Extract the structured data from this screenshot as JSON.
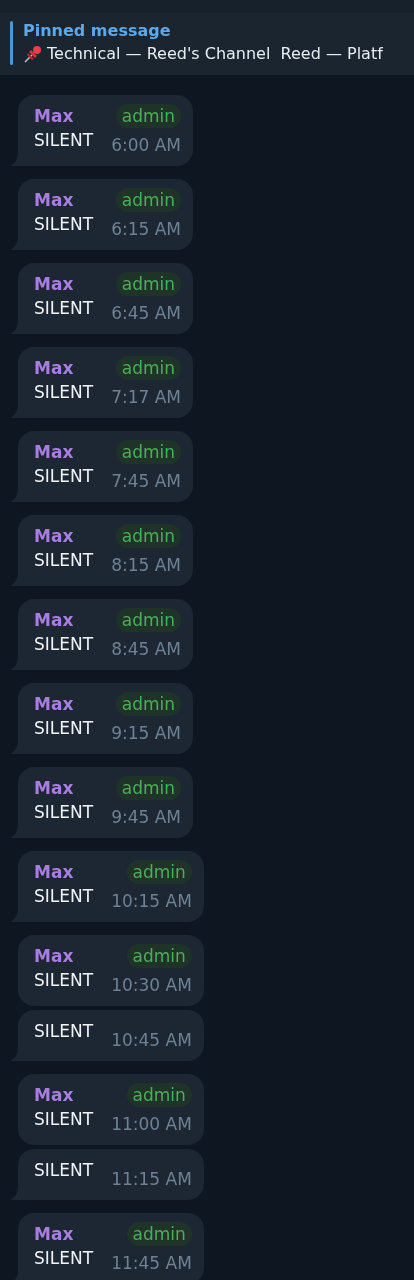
{
  "pinned": {
    "title": "Pinned message",
    "text": "Technical — Reed's Channel  Reed — Platf"
  },
  "messages": [
    {
      "sender": "Max",
      "badge": "admin",
      "text": "SILENT",
      "time": "6:00 AM"
    },
    {
      "sender": "Max",
      "badge": "admin",
      "text": "SILENT",
      "time": "6:15 AM"
    },
    {
      "sender": "Max",
      "badge": "admin",
      "text": "SILENT",
      "time": "6:45 AM"
    },
    {
      "sender": "Max",
      "badge": "admin",
      "text": "SILENT",
      "time": "7:17 AM"
    },
    {
      "sender": "Max",
      "badge": "admin",
      "text": "SILENT",
      "time": "7:45 AM"
    },
    {
      "sender": "Max",
      "badge": "admin",
      "text": "SILENT",
      "time": "8:15 AM"
    },
    {
      "sender": "Max",
      "badge": "admin",
      "text": "SILENT",
      "time": "8:45 AM"
    },
    {
      "sender": "Max",
      "badge": "admin",
      "text": "SILENT",
      "time": "9:15 AM"
    },
    {
      "sender": "Max",
      "badge": "admin",
      "text": "SILENT",
      "time": "9:45 AM"
    },
    {
      "sender": "Max",
      "badge": "admin",
      "text": "SILENT",
      "time": "10:15 AM"
    },
    {
      "sender": "Max",
      "badge": "admin",
      "text": "SILENT",
      "time": "10:30 AM"
    },
    {
      "text": "SILENT",
      "time": "10:45 AM"
    },
    {
      "sender": "Max",
      "badge": "admin",
      "text": "SILENT",
      "time": "11:00 AM"
    },
    {
      "text": "SILENT",
      "time": "11:15 AM"
    },
    {
      "sender": "Max",
      "badge": "admin",
      "text": "SILENT",
      "time": "11:45 AM"
    }
  ]
}
